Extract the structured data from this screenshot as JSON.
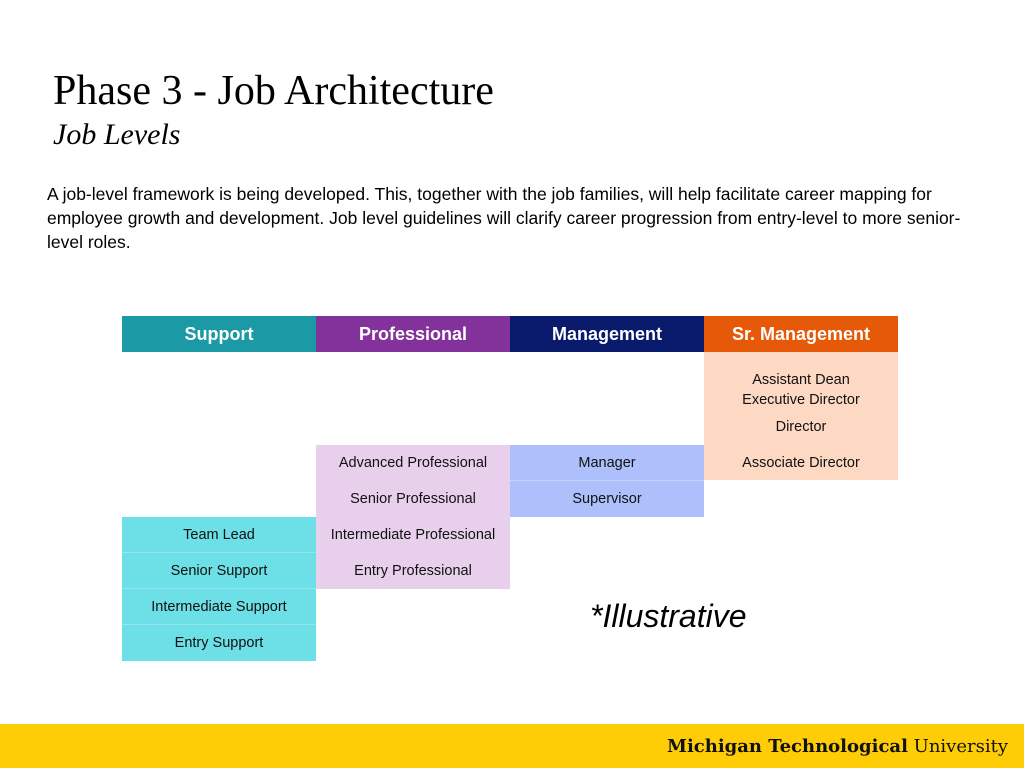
{
  "slide": {
    "title": "Phase 3 - Job Architecture",
    "subtitle": "Job Levels",
    "body": "A job-level framework is being developed. This, together with the job families, will help facilitate career mapping for employee growth and development. Job level guidelines will clarify career progression from entry-level to more senior-level roles.",
    "note": "*Illustrative"
  },
  "columns": [
    {
      "label": "Support",
      "color": "#1b9aa5",
      "fill": "#6ddfe6",
      "levels": [
        "Team Lead",
        "Senior Support",
        "Intermediate Support",
        "Entry Support"
      ]
    },
    {
      "label": "Professional",
      "color": "#82329a",
      "fill": "#e8d0ec",
      "levels": [
        "Advanced Professional",
        "Senior Professional",
        "Intermediate Professional",
        "Entry Professional"
      ]
    },
    {
      "label": "Management",
      "color": "#0a1b6e",
      "fill": "#adc0fb",
      "levels": [
        "Manager",
        "Supervisor"
      ]
    },
    {
      "label": "Sr. Management",
      "color": "#e55908",
      "fill": "#fdd9c4",
      "levels": [
        "Assistant Dean",
        "Executive Director",
        "Director",
        "Associate Director"
      ]
    }
  ],
  "footer": {
    "brand_bold": "Michigan Technological",
    "brand_light": "University",
    "color": "#fecd06"
  }
}
